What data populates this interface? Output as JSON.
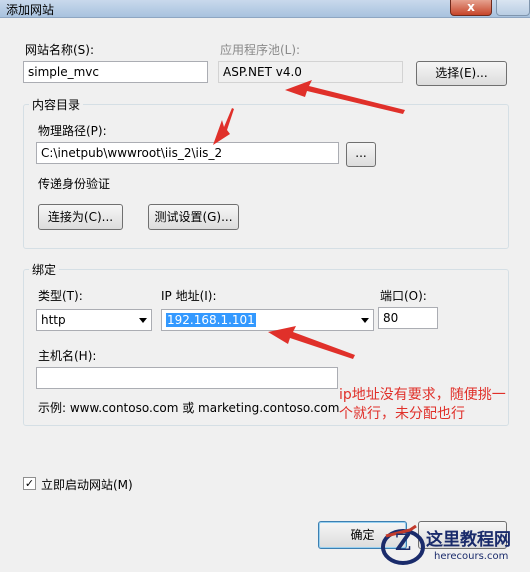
{
  "window": {
    "title": "添加网站",
    "close_glyph": "x"
  },
  "site": {
    "name_label": "网站名称(S):",
    "name_value": "simple_mvc",
    "pool_label": "应用程序池(L):",
    "pool_value": "ASP.NET v4.0",
    "select_button": "选择(E)..."
  },
  "content_dir": {
    "title": "内容目录",
    "path_label": "物理路径(P):",
    "path_value": "C:\\inetpub\\wwwroot\\iis_2\\iis_2",
    "browse_button": "...",
    "auth_label": "传递身份验证",
    "connect_button": "连接为(C)...",
    "test_button": "测试设置(G)..."
  },
  "binding": {
    "title": "绑定",
    "type_label": "类型(T):",
    "type_value": "http",
    "ip_label": "IP 地址(I):",
    "ip_value": "192.168.1.101",
    "port_label": "端口(O):",
    "port_value": "80",
    "host_label": "主机名(H):",
    "host_value": "",
    "example_text": "示例: www.contoso.com 或 marketing.contoso.com"
  },
  "start_now": {
    "label": "立即启动网站(M)",
    "checked": true,
    "check_glyph": "✓"
  },
  "footer": {
    "ok_button": "确定",
    "cancel_button": ""
  },
  "annotation": {
    "line1": "ip地址没有要求，随便挑一",
    "line2": "个就行，未分配也行",
    "color": "#e0302a"
  },
  "watermark": {
    "title": "这里教程网",
    "url": "herecours.com",
    "logo_letter": "Z"
  }
}
